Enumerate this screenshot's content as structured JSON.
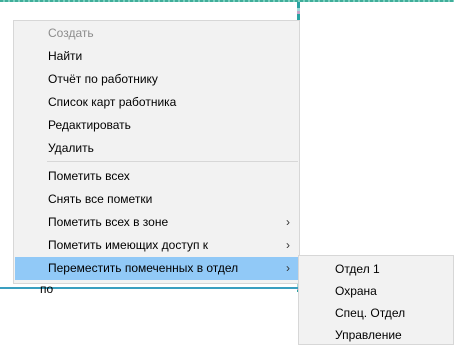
{
  "background": {
    "partial_text": "по"
  },
  "menu": {
    "items": [
      {
        "label": "Создать",
        "disabled": true
      },
      {
        "label": "Найти"
      },
      {
        "label": "Отчёт по работнику"
      },
      {
        "label": "Список карт работника"
      },
      {
        "label": "Редактировать"
      },
      {
        "label": "Удалить"
      },
      {
        "label": "Пометить всех"
      },
      {
        "label": "Снять все пометки"
      },
      {
        "label": "Пометить всех в зоне",
        "submenu": true
      },
      {
        "label": "Пометить имеющих доступ к",
        "submenu": true
      },
      {
        "label": "Переместить помеченных в отдел",
        "submenu": true,
        "selected": true
      }
    ],
    "arrow_glyph": "›"
  },
  "submenu": {
    "items": [
      {
        "label": "Отдел 1"
      },
      {
        "label": "Охрана"
      },
      {
        "label": "Спец. Отдел"
      },
      {
        "label": "Управление"
      }
    ]
  },
  "colors": {
    "selection": "#91c9f7",
    "menu_bg": "#f2f2f2",
    "disabled_text": "#8c8c8c"
  }
}
